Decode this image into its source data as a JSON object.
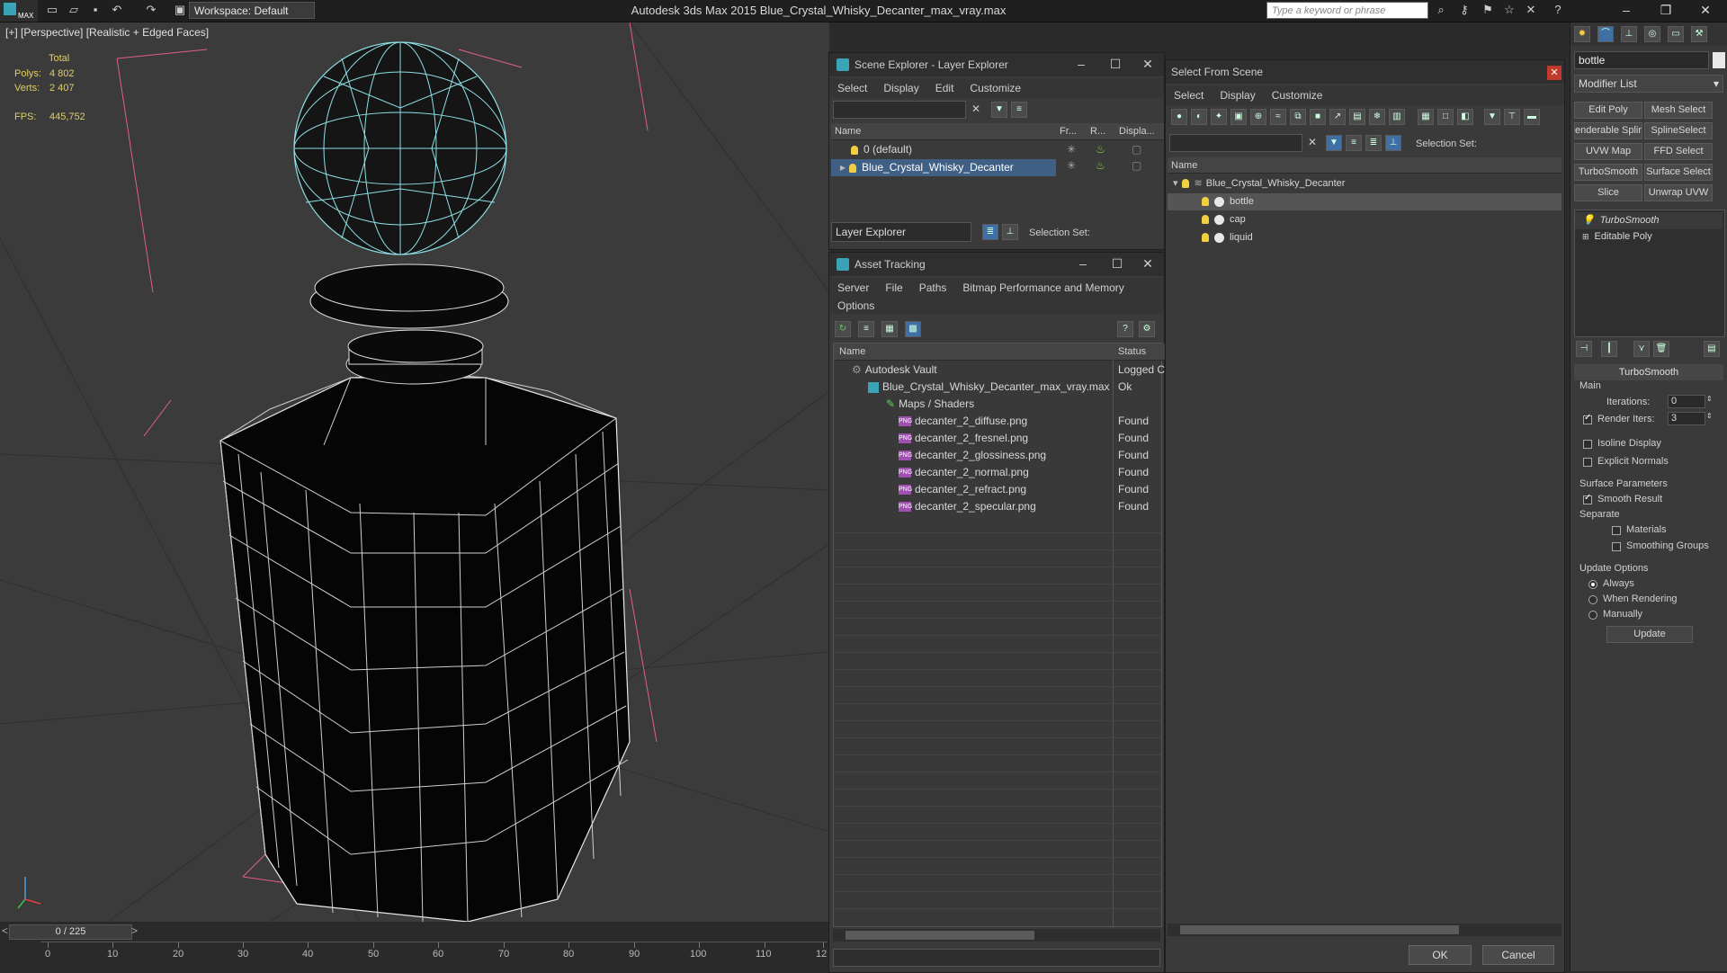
{
  "app": {
    "title": "Autodesk 3ds Max  2015     Blue_Crystal_Whisky_Decanter_max_vray.max",
    "logo_text": "MAX",
    "workspace": "Workspace: Default",
    "search_placeholder": "Type a keyword or phrase"
  },
  "viewport": {
    "label": "[+] [Perspective] [Realistic + Edged Faces]",
    "stats": {
      "total_label": "Total",
      "polys_label": "Polys:",
      "polys_value": "4 802",
      "verts_label": "Verts:",
      "verts_value": "2 407",
      "fps_label": "FPS:",
      "fps_value": "445,752"
    }
  },
  "timeline": {
    "frame": "0 / 225",
    "prev": "<",
    "next": ">",
    "ticks": [
      "0",
      "10",
      "20",
      "30",
      "40",
      "50",
      "60",
      "70",
      "80",
      "90",
      "100",
      "110",
      "12"
    ]
  },
  "scene_explorer": {
    "title": "Scene Explorer - Layer Explorer",
    "menu": [
      "Select",
      "Display",
      "Edit",
      "Customize"
    ],
    "columns": {
      "name": "Name",
      "frozen": "Fr...",
      "render": "R...",
      "display": "Displa..."
    },
    "rows": [
      {
        "name": "0 (default)"
      },
      {
        "name": "Blue_Crystal_Whisky_Decanter"
      }
    ],
    "footer_dropdown": "Layer Explorer",
    "selection_set_label": "Selection Set:"
  },
  "asset_tracking": {
    "title": "Asset Tracking",
    "menu": [
      "Server",
      "File",
      "Paths",
      "Bitmap Performance and Memory"
    ],
    "menu2": "Options",
    "columns": {
      "name": "Name",
      "status": "Status"
    },
    "rows": [
      {
        "name": "Autodesk Vault",
        "status": "Logged C"
      },
      {
        "name": "Blue_Crystal_Whisky_Decanter_max_vray.max",
        "status": "Ok"
      },
      {
        "name": "Maps / Shaders",
        "status": ""
      },
      {
        "name": "decanter_2_diffuse.png",
        "status": "Found"
      },
      {
        "name": "decanter_2_fresnel.png",
        "status": "Found"
      },
      {
        "name": "decanter_2_glossiness.png",
        "status": "Found"
      },
      {
        "name": "decanter_2_normal.png",
        "status": "Found"
      },
      {
        "name": "decanter_2_refract.png",
        "status": "Found"
      },
      {
        "name": "decanter_2_specular.png",
        "status": "Found"
      }
    ],
    "png_badge": "PNG"
  },
  "select_from_scene": {
    "title": "Select From Scene",
    "menu": [
      "Select",
      "Display",
      "Customize"
    ],
    "selection_set_label": "Selection Set:",
    "column_name": "Name",
    "tree": [
      {
        "name": "Blue_Crystal_Whisky_Decanter",
        "level": 0
      },
      {
        "name": "bottle",
        "level": 1
      },
      {
        "name": "cap",
        "level": 1
      },
      {
        "name": "liquid",
        "level": 1
      }
    ],
    "ok_label": "OK",
    "cancel_label": "Cancel"
  },
  "command_panel": {
    "object_name": "bottle",
    "modifier_list": "Modifier List",
    "buttons": [
      [
        "Edit Poly",
        "Mesh Select"
      ],
      [
        "enderable Splir",
        "SplineSelect"
      ],
      [
        "UVW Map",
        "FFD Select"
      ],
      [
        "TurboSmooth",
        "Surface Select"
      ],
      [
        "Slice",
        "Unwrap UVW"
      ]
    ],
    "stack": [
      "TurboSmooth",
      "Editable Poly"
    ],
    "rollout_title": "TurboSmooth",
    "main_label": "Main",
    "iterations_label": "Iterations:",
    "iterations_value": "0",
    "render_iters_label": "Render Iters:",
    "render_iters_value": "3",
    "isoline_label": "Isoline Display",
    "explicit_normals_label": "Explicit Normals",
    "surface_params_label": "Surface Parameters",
    "smooth_result_label": "Smooth Result",
    "separate_label": "Separate",
    "materials_label": "Materials",
    "smoothing_groups_label": "Smoothing Groups",
    "update_options_label": "Update Options",
    "always_label": "Always",
    "when_rendering_label": "When Rendering",
    "manually_label": "Manually",
    "update_button": "Update"
  },
  "colors": {
    "accent_selection": "#3f5f85",
    "viewport_bg": "#3b3b3b",
    "wire_cap": "#8fe0e6",
    "bounding_box": "#e06080"
  }
}
